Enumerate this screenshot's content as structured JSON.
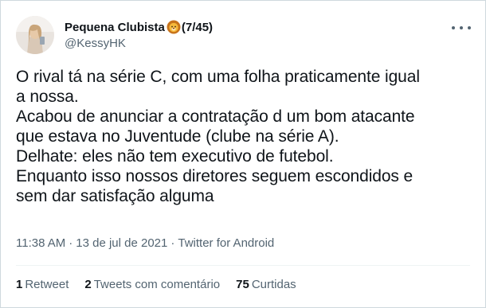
{
  "author": {
    "display_name": "Pequena Clubista",
    "name_suffix": "(7/45)",
    "badge_icon": "lion-face-icon",
    "handle": "@KessyHK",
    "avatar_icon": "profile-avatar"
  },
  "more_icon": "more-horizontal-icon",
  "tweet_lines": [
    "O rival tá na série C, com uma folha praticamente igual",
    "a nossa.",
    "Acabou de anunciar a contratação d um bom atacante",
    "que estava no Juventude (clube na série A).",
    "Delhate: eles não tem executivo de futebol.",
    "Enquanto isso nossos diretores seguem escondidos e",
    "sem dar satisfação alguma"
  ],
  "meta": {
    "time": "11:38 AM",
    "separator": "·",
    "date": "13 de jul de 2021",
    "source": "Twitter for Android"
  },
  "stats": {
    "retweets_count": "1",
    "retweets_label": "Retweet",
    "quotes_count": "2",
    "quotes_label": "Tweets com comentário",
    "likes_count": "75",
    "likes_label": "Curtidas"
  },
  "colors": {
    "text": "#0f1419",
    "secondary": "#536471",
    "border": "#cfd9de",
    "divider": "#eff3f4"
  }
}
